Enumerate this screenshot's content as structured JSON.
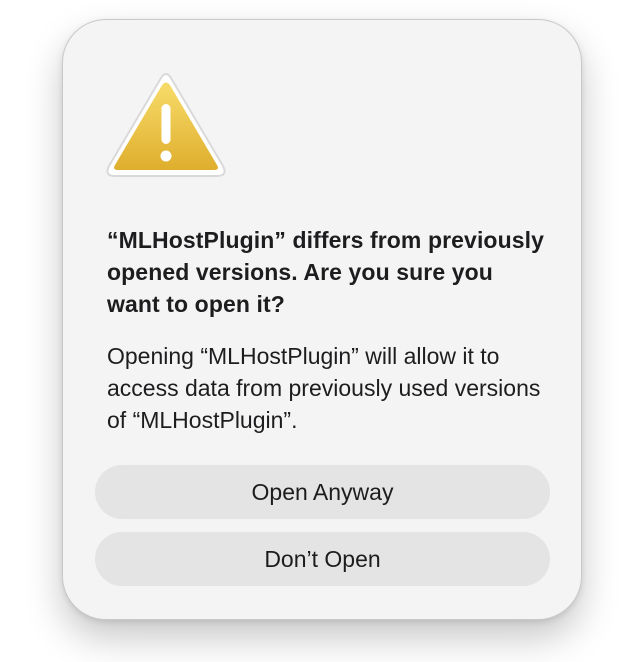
{
  "dialog": {
    "title": "“MLHostPlugin” differs from previously opened versions. Are you sure you want to open it?",
    "message": "Opening “MLHostPlugin” will allow it to access data from previously used versions of “MLHostPlugin”.",
    "icon": "warning-icon",
    "buttons": {
      "open_anyway": "Open Anyway",
      "dont_open": "Don’t Open"
    }
  },
  "colors": {
    "dialog_background": "#f5f4f4",
    "button_background": "#e5e4e4",
    "text": "#1d1d1f",
    "warning_yellow": "#f2c94c"
  }
}
